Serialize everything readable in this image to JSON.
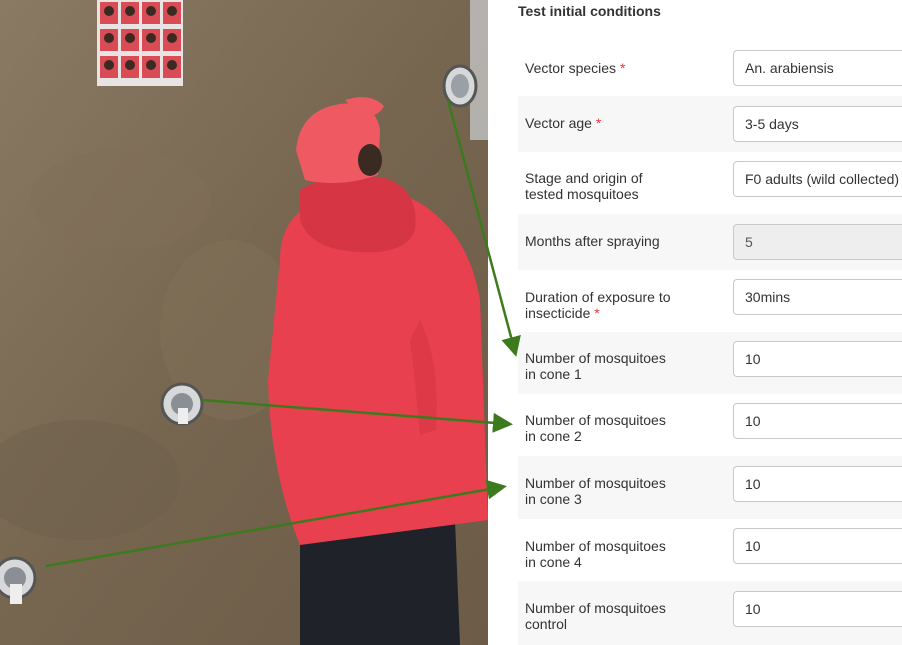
{
  "form": {
    "title": "Test initial conditions",
    "required_marker": "*",
    "fields": [
      {
        "label": "Vector species",
        "required": true,
        "value": "An. arabiensis"
      },
      {
        "label": "Vector age",
        "required": true,
        "value": "3-5 days"
      },
      {
        "label_line1": "Stage and origin of",
        "label_line2": "tested mosquitoes",
        "value": "F0 adults (wild collected)"
      },
      {
        "label": "Months after spraying",
        "value": "5",
        "disabled": true
      },
      {
        "label_line1": "Duration of exposure to",
        "label_line2": "insecticide",
        "required": true,
        "value": "30mins"
      },
      {
        "label_line1": "Number of mosquitoes",
        "label_line2": "in cone 1",
        "value": "10"
      },
      {
        "label_line1": "Number of mosquitoes",
        "label_line2": "in cone 2",
        "value": "10"
      },
      {
        "label_line1": "Number of mosquitoes",
        "label_line2": "in cone 3",
        "value": "10"
      },
      {
        "label_line1": "Number of mosquitoes",
        "label_line2": "in cone 4",
        "value": "10"
      },
      {
        "label_line1": "Number of mosquitoes",
        "label_line2": "control",
        "value": "10"
      }
    ]
  },
  "colors": {
    "arrow": "#3d7a1e",
    "required": "#e53935",
    "wall": "#7a6a55"
  }
}
